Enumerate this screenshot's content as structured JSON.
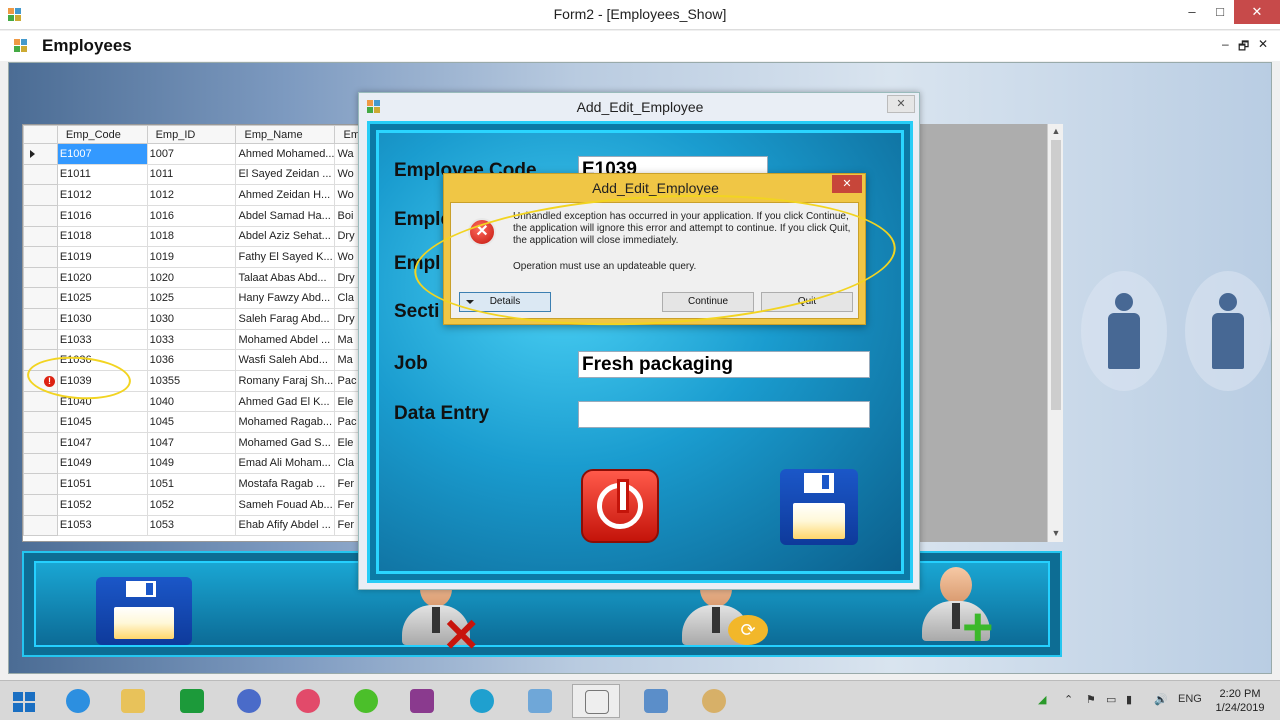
{
  "window": {
    "title": "Form2 - [Employees_Show]",
    "minimize": "–",
    "maximize": "□",
    "close": "✕"
  },
  "mdi": {
    "title": "Employees",
    "minimize": "–",
    "restore": "🗗",
    "close": "✕"
  },
  "grid": {
    "columns": [
      "Emp_Code",
      "Emp_ID",
      "Emp_Name",
      "Em"
    ],
    "rows": [
      {
        "code": "E1007",
        "id": "1007",
        "name": "Ahmed Mohamed...",
        "e": "Wa"
      },
      {
        "code": "E1011",
        "id": "1011",
        "name": "El Sayed Zeidan ...",
        "e": "Wo"
      },
      {
        "code": "E1012",
        "id": "1012",
        "name": "Ahmed  Zeidan H...",
        "e": "Wo"
      },
      {
        "code": "E1016",
        "id": "1016",
        "name": "Abdel Samad Ha...",
        "e": "Boi"
      },
      {
        "code": "E1018",
        "id": "1018",
        "name": "Abdel Aziz Sehat...",
        "e": "Dry"
      },
      {
        "code": "E1019",
        "id": "1019",
        "name": "Fathy El Sayed K...",
        "e": "Wo"
      },
      {
        "code": "E1020",
        "id": "1020",
        "name": "Talaat Abas Abd...",
        "e": "Dry"
      },
      {
        "code": "E1025",
        "id": "1025",
        "name": "Hany Fawzy Abd...",
        "e": "Cla"
      },
      {
        "code": "E1030",
        "id": "1030",
        "name": "Saleh Farag Abd...",
        "e": "Dry"
      },
      {
        "code": "E1033",
        "id": "1033",
        "name": "Mohamed Abdel ...",
        "e": "Ma"
      },
      {
        "code": "E1036",
        "id": "1036",
        "name": "Wasfi Saleh Abd...",
        "e": "Ma"
      },
      {
        "code": "E1039",
        "id": "10355",
        "name": "Romany Faraj Sh...",
        "e": "Pac"
      },
      {
        "code": "E1040",
        "id": "1040",
        "name": "Ahmed Gad El K...",
        "e": "Ele"
      },
      {
        "code": "E1045",
        "id": "1045",
        "name": "Mohamed Ragab...",
        "e": "Pac"
      },
      {
        "code": "E1047",
        "id": "1047",
        "name": "Mohamed Gad S...",
        "e": "Ele"
      },
      {
        "code": "E1049",
        "id": "1049",
        "name": "Emad Ali Moham...",
        "e": "Cla"
      },
      {
        "code": "E1051",
        "id": "1051",
        "name": "Mostafa Ragab ...",
        "e": "Fer"
      },
      {
        "code": "E1052",
        "id": "1052",
        "name": "Sameh Fouad Ab...",
        "e": "Fer"
      },
      {
        "code": "E1053",
        "id": "1053",
        "name": "Ehab Afify Abdel ...",
        "e": "Fer"
      }
    ],
    "error_marker": "!"
  },
  "edit_dialog": {
    "title": "Add_Edit_Employee",
    "close": "✕",
    "labels": {
      "code": "Employee Code",
      "name": "Emple",
      "emp": "Empl",
      "section": "Secti",
      "job": "Job",
      "data_entry": "Data Entry"
    },
    "values": {
      "code": "E1039",
      "job": "Fresh packaging",
      "data_entry": ""
    }
  },
  "error_dialog": {
    "title": "Add_Edit_Employee",
    "close": "✕",
    "icon": "✕",
    "text": "Unhandled exception has occurred in your application. If you click Continue, the application will ignore this error and attempt to continue. If you click Quit, the application will close immediately.",
    "message": "Operation must use an updateable query.",
    "details": "Details",
    "continue": "Continue",
    "quit": "Quit"
  },
  "taskbar": {
    "lang": "ENG",
    "time": "2:20 PM",
    "date": "1/24/2019"
  },
  "colors": {
    "accent": "#27cdf7",
    "dialog_yellow": "#f0c645",
    "annotation": "#f2d421",
    "selection": "#3399ff"
  }
}
